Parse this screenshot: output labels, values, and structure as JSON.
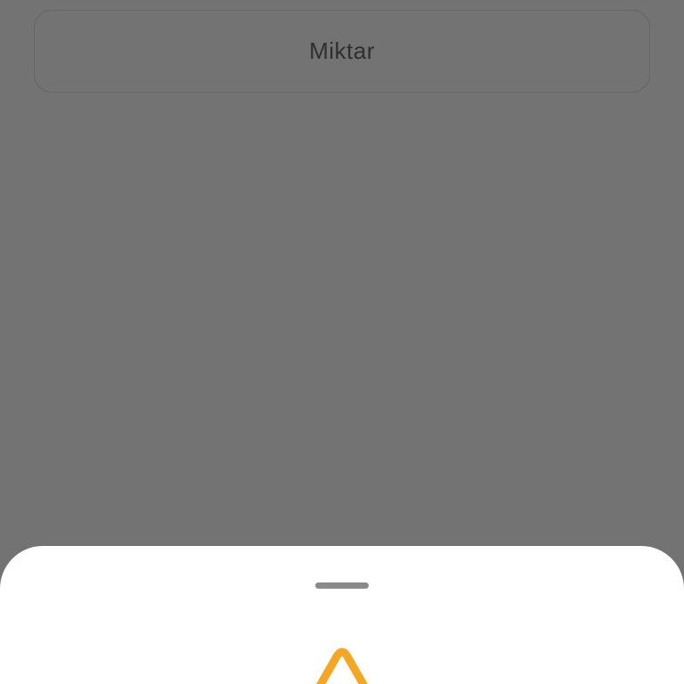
{
  "form": {
    "amount_label": "Miktar"
  },
  "bottom_sheet": {
    "icon": "warning-icon",
    "icon_color": "#F5A623"
  },
  "colors": {
    "overlay": "#737373",
    "sheet_background": "#FFFFFF"
  }
}
